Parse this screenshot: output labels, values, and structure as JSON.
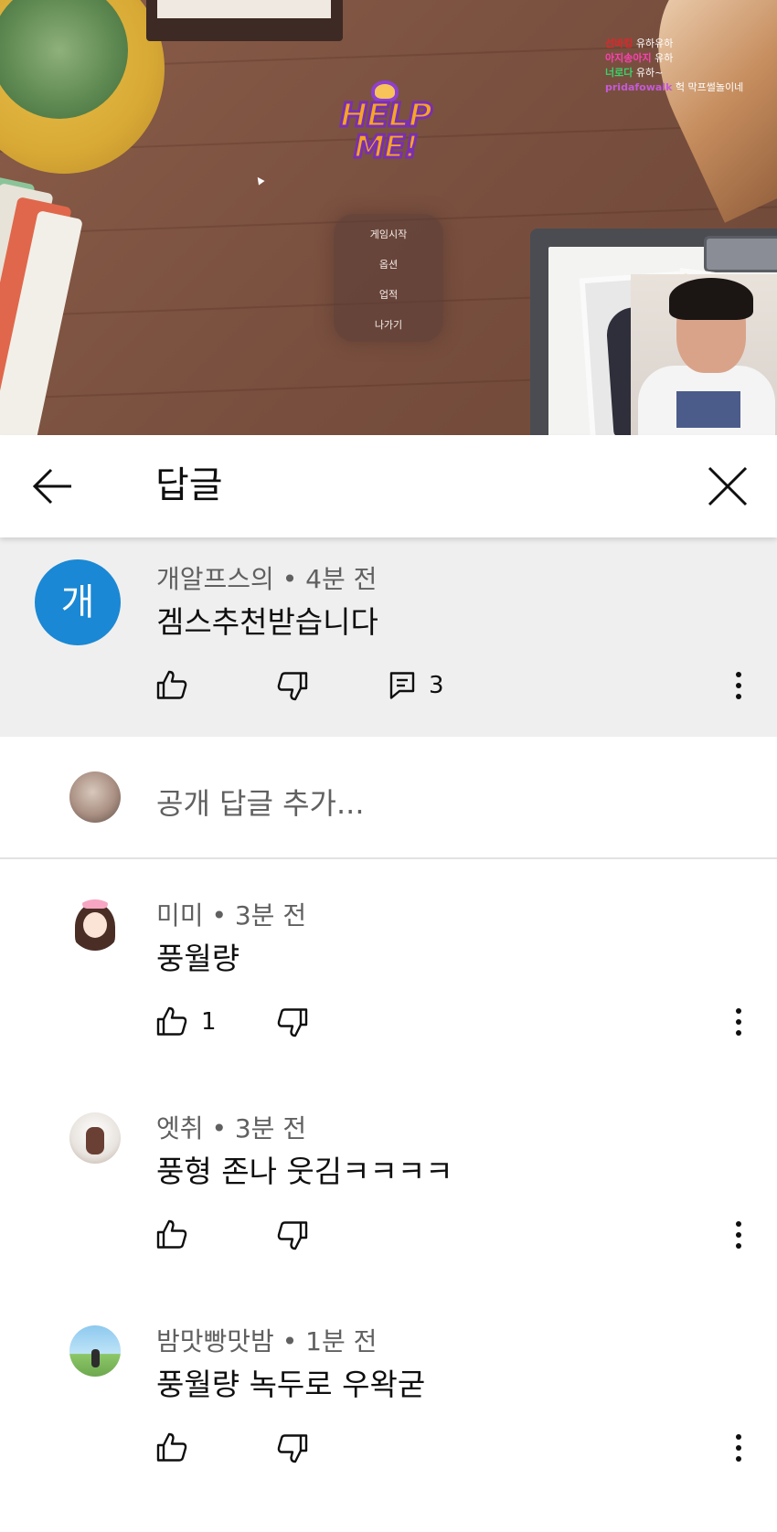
{
  "video": {
    "logo_line1": "HELP",
    "logo_line2": "ME!",
    "menu": [
      "게임시작",
      "옵션",
      "업적",
      "나가기"
    ],
    "chat": [
      {
        "user": "선바킹",
        "msg": "유하유하",
        "color": "#e0262b"
      },
      {
        "user": "아지송아지",
        "msg": "유하",
        "color": "#ff3fb4"
      },
      {
        "user": "너로다",
        "msg": "유하~",
        "color": "#39d36a"
      },
      {
        "user": "pridafowalk",
        "msg": "헉 막프썰놀이네",
        "color": "#c45ad8"
      }
    ]
  },
  "header": {
    "title": "답글"
  },
  "parent_comment": {
    "avatar_letter": "개",
    "avatar_color": "#1a88d4",
    "author": "개알프스의",
    "time": "4분 전",
    "text": "겜스추천받습니다",
    "reply_count": "3"
  },
  "add_reply": {
    "placeholder": "공개 답글 추가..."
  },
  "replies": [
    {
      "author": "미미",
      "time": "3분 전",
      "text": "풍월량",
      "likes": "1"
    },
    {
      "author": "엣취",
      "time": "3분 전",
      "text": "풍형 존나 웃김ㅋㅋㅋㅋ",
      "likes": ""
    },
    {
      "author": "밤맛빵맛밤",
      "time": "1분 전",
      "text": "풍월량 녹두로 우왁굳",
      "likes": ""
    }
  ]
}
